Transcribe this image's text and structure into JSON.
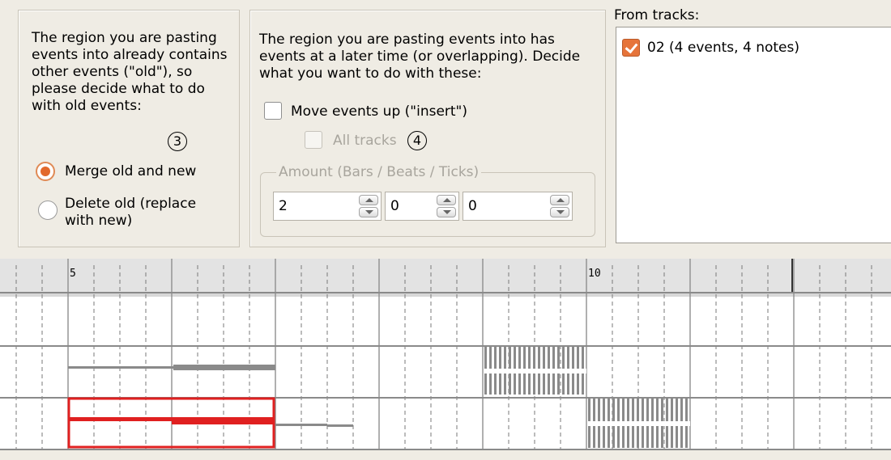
{
  "left_panel": {
    "description": "The region you are pasting events into already contains other events (\"old\"), so please decide what to do with old events:",
    "callout": "3",
    "options": [
      {
        "label": "Merge old and new",
        "selected": true
      },
      {
        "label": "Delete old (replace with new)",
        "selected": false
      }
    ]
  },
  "mid_panel": {
    "description": "The region you are pasting events into has events at a later time (or overlapping). Decide what you want to do with these:",
    "move_events_label": "Move events up (\"insert\")",
    "all_tracks_label": "All tracks",
    "callout": "4",
    "amount_legend": "Amount (Bars / Beats / Ticks)",
    "bars": "2",
    "beats": "0",
    "ticks": "0"
  },
  "right_panel": {
    "title": "From tracks:",
    "tracks": [
      {
        "label": "02 (4 events, 4 notes)",
        "checked": true
      }
    ]
  },
  "ruler": {
    "markers": [
      {
        "label": "5",
        "bar": 5
      },
      {
        "label": "10",
        "bar": 10
      }
    ]
  },
  "colors": {
    "accent": "#e2692c",
    "selection": "#e02020",
    "events": "#8a8a8a"
  }
}
